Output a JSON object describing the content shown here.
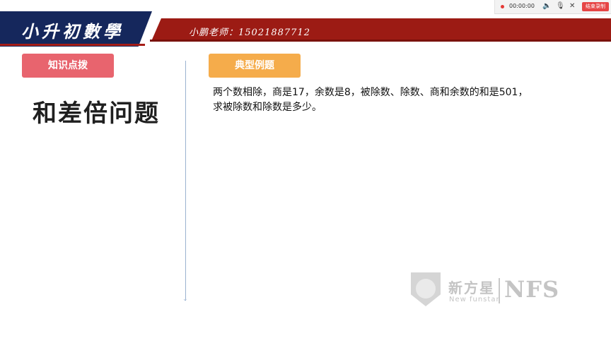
{
  "header": {
    "title": "小升初數學",
    "teacher": "小鹏老师：15021887712"
  },
  "recorder": {
    "time": "00:00:00",
    "icons": [
      "speaker-icon",
      "microphone-icon",
      "close-icon"
    ],
    "end_label": "结束录制",
    "end_color": "#e64545"
  },
  "left_panel": {
    "tag": "知识点拨",
    "tag_color": "#e8646e",
    "topic": "和差倍问题"
  },
  "right_panel": {
    "tag": "典型例题",
    "tag_color": "#f5ac4b",
    "problem_line1": "两个数相除，商是17，余数是8，被除数、除数、商和余数的和是501，",
    "problem_line2": "求被除数和除数是多少。"
  },
  "watermark": {
    "brand_cn": "新方星",
    "brand_en": "New funstar",
    "brand_abbr": "NFS"
  }
}
